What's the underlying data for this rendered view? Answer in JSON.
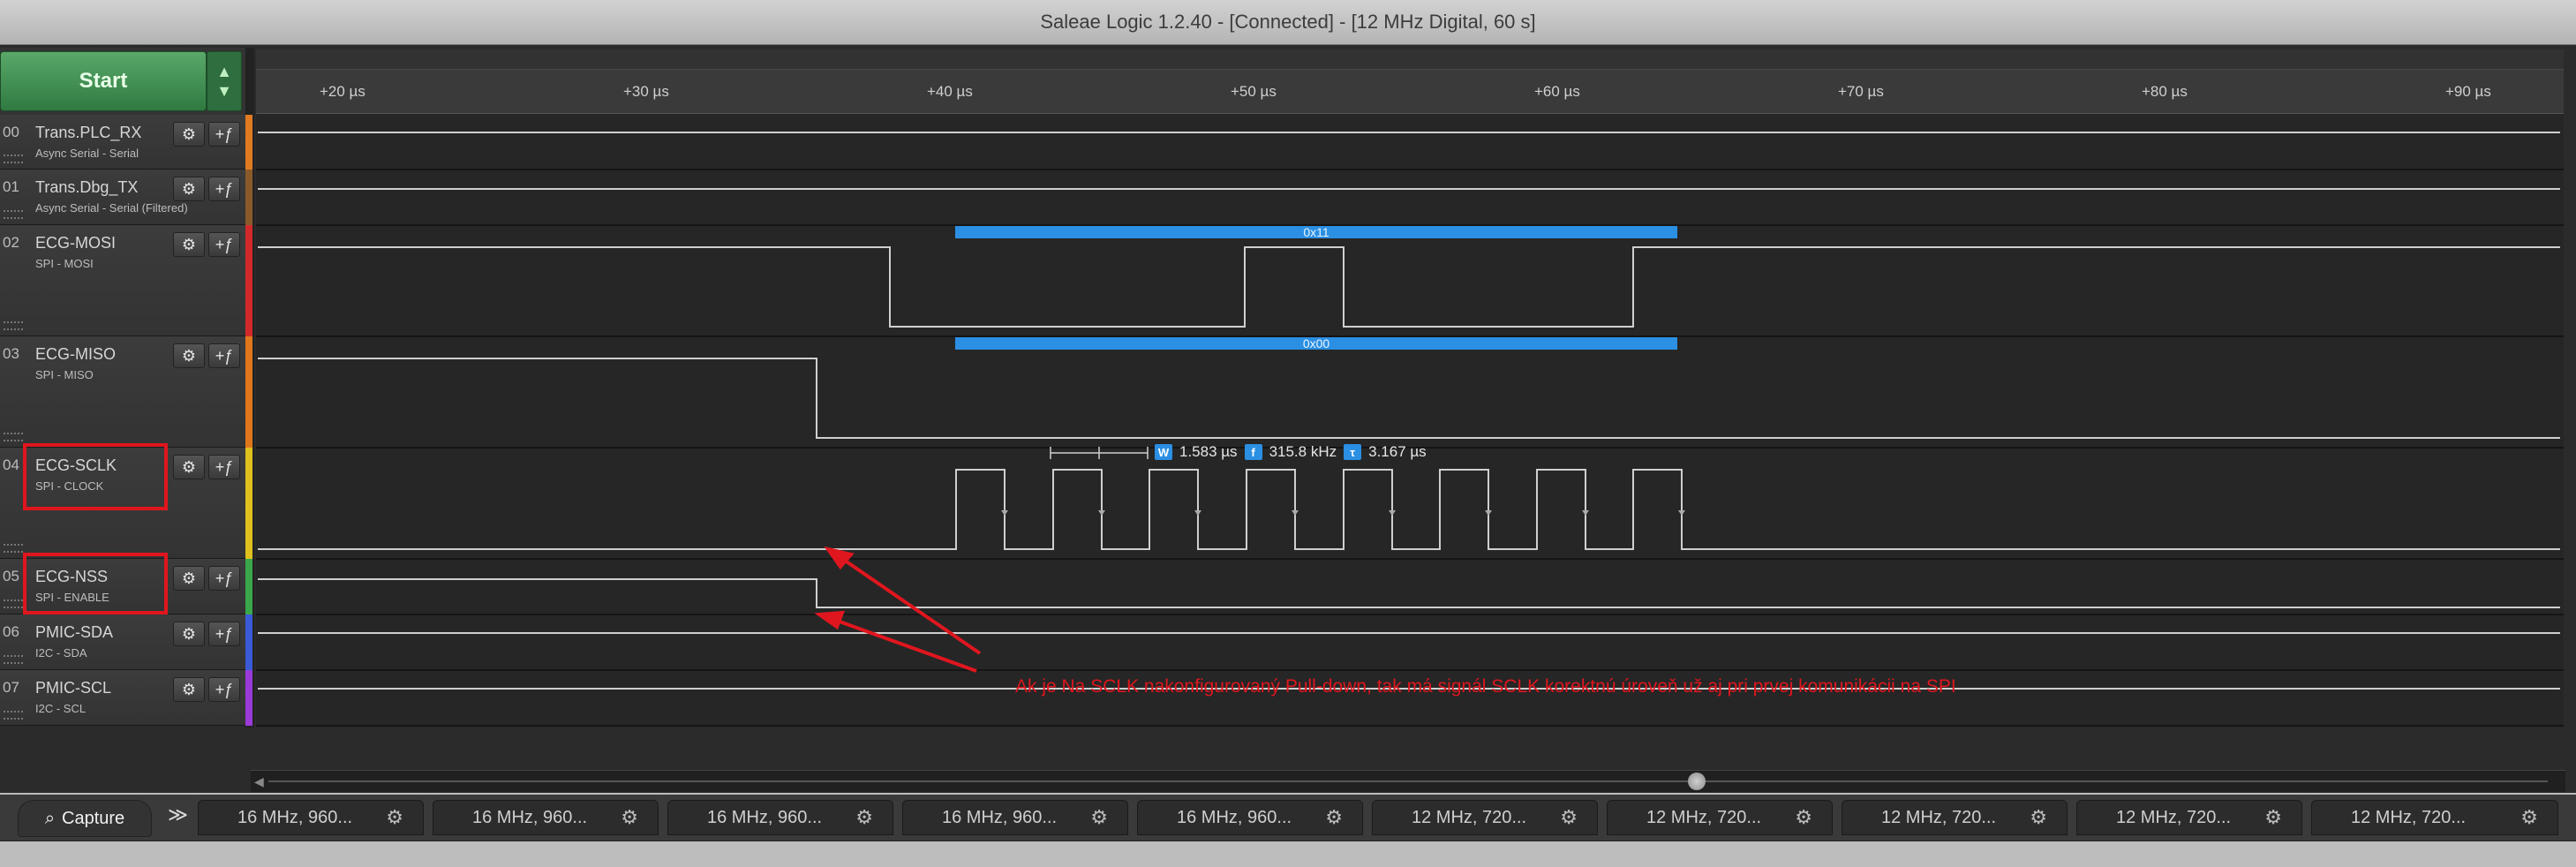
{
  "window": {
    "title": "Saleae Logic 1.2.40 - [Connected] - [12 MHz Digital, 60 s]"
  },
  "start": {
    "label": "Start"
  },
  "ruler": {
    "ticks": [
      "+20 µs",
      "+30 µs",
      "+40 µs",
      "+50 µs",
      "+60 µs",
      "+70 µs",
      "+80 µs",
      "+90 µs"
    ]
  },
  "channels": [
    {
      "num": "00",
      "name": "Trans.PLC_RX",
      "analyzer": "Async Serial - Serial",
      "color": "#e07b22"
    },
    {
      "num": "01",
      "name": "Trans.Dbg_TX",
      "analyzer": "Async Serial - Serial (Filtered)",
      "color": "#8a5a2b"
    },
    {
      "num": "02",
      "name": "ECG-MOSI",
      "analyzer": "SPI - MOSI",
      "color": "#d22a2a"
    },
    {
      "num": "03",
      "name": "ECG-MISO",
      "analyzer": "SPI - MISO",
      "color": "#e0761c"
    },
    {
      "num": "04",
      "name": "ECG-SCLK",
      "analyzer": "SPI - CLOCK",
      "color": "#e0c01c"
    },
    {
      "num": "05",
      "name": "ECG-NSS",
      "analyzer": "SPI - ENABLE",
      "color": "#3aa84a"
    },
    {
      "num": "06",
      "name": "PMIC-SDA",
      "analyzer": "I2C - SDA",
      "color": "#3a5ad8"
    },
    {
      "num": "07",
      "name": "PMIC-SCL",
      "analyzer": "I2C - SCL",
      "color": "#9a3ad8"
    }
  ],
  "decoded": {
    "mosi": "0x11",
    "miso": "0x00"
  },
  "measurement": {
    "w_icon": "W",
    "width": "1.583 µs",
    "f_icon": "f",
    "freq": "315.8 kHz",
    "t_icon": "τ",
    "period": "3.167 µs"
  },
  "annotation": "Ak je Na SCLK nakonfigurovaný Pull-down, tak má signál SCLK korektnú úroveň už aj pri prvej komunikácii na SPI",
  "bottom": {
    "capture_label": "Capture",
    "more_label": "≫",
    "tabs": [
      "16 MHz, 960...",
      "16 MHz, 960...",
      "16 MHz, 960...",
      "16 MHz, 960...",
      "16 MHz, 960...",
      "12 MHz, 720...",
      "12 MHz, 720...",
      "12 MHz, 720...",
      "12 MHz, 720...",
      "12 MHz, 720..."
    ]
  },
  "colors": {
    "waveform": "#cfcfcf",
    "decoded_bar": "#2b8fe3",
    "annotation": "#e0161e"
  }
}
